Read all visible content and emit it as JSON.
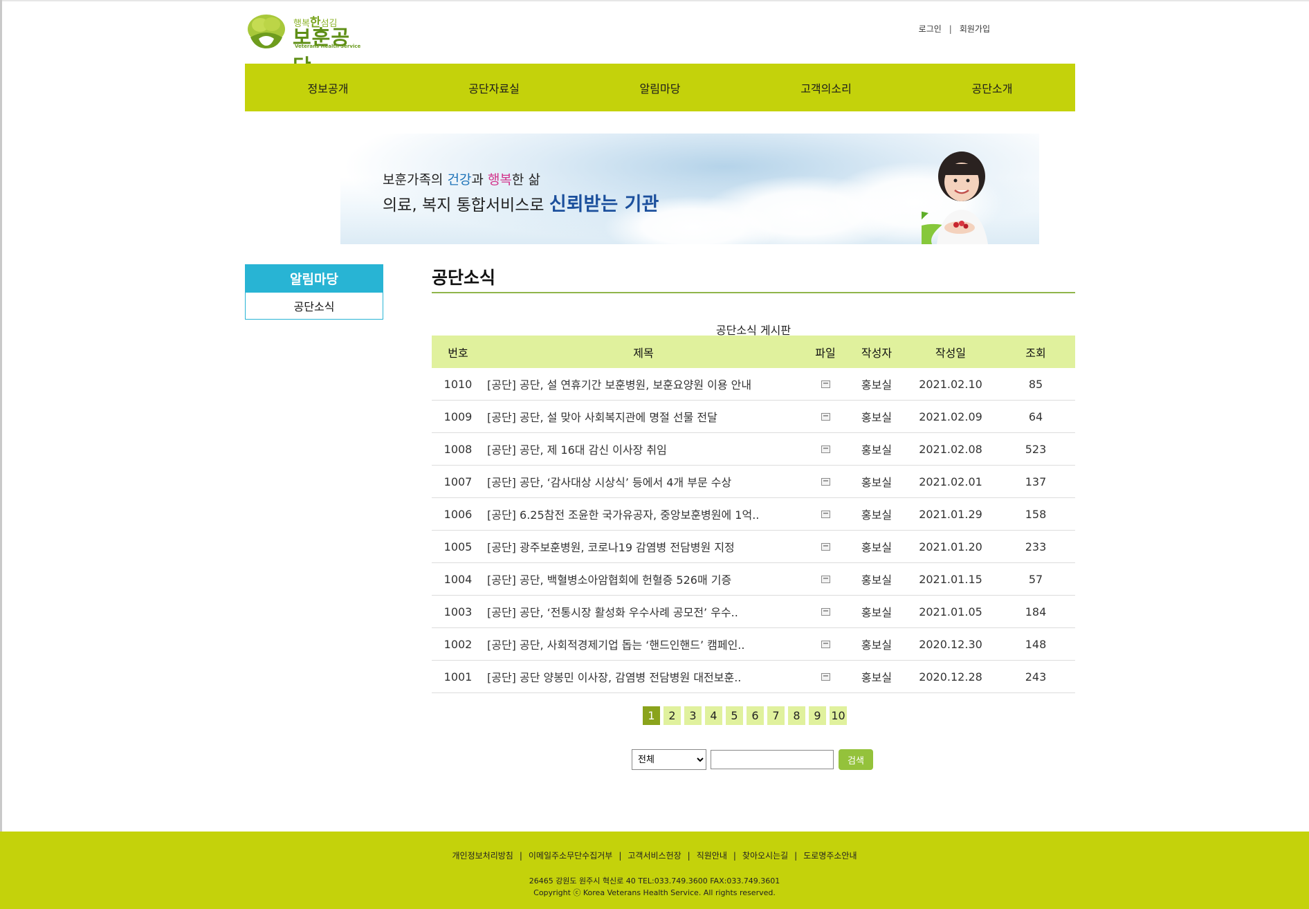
{
  "header": {
    "logo_tagline_pre": "행복",
    "logo_tagline_bold": "한",
    "logo_tagline_post": "섬김",
    "logo_main": "보훈공단",
    "logo_sub": "Veterans Health Service",
    "login": "로그인",
    "util_separator": "|",
    "signup": "회원가입"
  },
  "gnb": {
    "items": [
      "정보공개",
      "공단자료실",
      "알림마당",
      "고객의소리",
      "공단소개"
    ]
  },
  "banner": {
    "line1_a": "보훈가족의 ",
    "line1_b": "건강",
    "line1_c": "과 ",
    "line1_d": "행복",
    "line1_e": "한 삶",
    "line2_a": "의료, 복지 통합서비스로 ",
    "line2_b": "신뢰받는 기관"
  },
  "lnb": {
    "title": "알림마당",
    "item": "공단소식"
  },
  "content": {
    "title": "공단소식",
    "caption": "공단소식 게시판",
    "columns": [
      "번호",
      "제목",
      "파일",
      "작성자",
      "작성일",
      "조회"
    ],
    "rows": [
      {
        "no": "1010",
        "subject": "[공단] 공단, 설 연휴기간 보훈병원, 보훈요양원 이용 안내",
        "writer": "홍보실",
        "date": "2021.02.10",
        "views": "85"
      },
      {
        "no": "1009",
        "subject": "[공단] 공단, 설 맞아 사회복지관에 명절 선물 전달",
        "writer": "홍보실",
        "date": "2021.02.09",
        "views": "64"
      },
      {
        "no": "1008",
        "subject": "[공단] 공단, 제 16대 감신 이사장 취임",
        "writer": "홍보실",
        "date": "2021.02.08",
        "views": "523"
      },
      {
        "no": "1007",
        "subject": "[공단] 공단, ‘감사대상 시상식’ 등에서 4개 부문 수상",
        "writer": "홍보실",
        "date": "2021.02.01",
        "views": "137"
      },
      {
        "no": "1006",
        "subject": "[공단] 6.25참전 조윤한 국가유공자, 중앙보훈병원에 1억..",
        "writer": "홍보실",
        "date": "2021.01.29",
        "views": "158"
      },
      {
        "no": "1005",
        "subject": "[공단] 광주보훈병원, 코로나19 감염병 전담병원 지정",
        "writer": "홍보실",
        "date": "2021.01.20",
        "views": "233"
      },
      {
        "no": "1004",
        "subject": "[공단] 공단, 백혈병소아암협회에 헌혈증 526매 기증",
        "writer": "홍보실",
        "date": "2021.01.15",
        "views": "57"
      },
      {
        "no": "1003",
        "subject": "[공단] 공단, ‘전통시장 활성화 우수사례 공모전’ 우수..",
        "writer": "홍보실",
        "date": "2021.01.05",
        "views": "184"
      },
      {
        "no": "1002",
        "subject": "[공단] 공단, 사회적경제기업 돕는 ‘핸드인핸드’ 캠페인..",
        "writer": "홍보실",
        "date": "2020.12.30",
        "views": "148"
      },
      {
        "no": "1001",
        "subject": "[공단] 공단 양봉민 이사장, 감염병 전담병원 대전보훈..",
        "writer": "홍보실",
        "date": "2020.12.28",
        "views": "243"
      }
    ]
  },
  "pagination": {
    "pages": [
      "1",
      "2",
      "3",
      "4",
      "5",
      "6",
      "7",
      "8",
      "9",
      "10"
    ],
    "current": "1"
  },
  "search": {
    "select_value": "전체",
    "input_value": "",
    "button": "검색"
  },
  "footer": {
    "links": [
      "개인정보처리방침",
      "이메일주소무단수집거부",
      "고객서비스헌장",
      "직원안내",
      "찾아오시는길",
      "도로명주소안내"
    ],
    "separator": "|",
    "address": "26465 강원도 원주시 혁신로 40 TEL:033.749.3600 FAX:033.749.3601",
    "copyright": "Copyright ⓒ Korea Veterans Health Service. All rights reserved."
  },
  "colors": {
    "brand_green": "#c4d20b",
    "table_header": "#e0f19d",
    "lnb_blue": "#28b4d4",
    "pager_active": "#8aa31c",
    "search_button": "#94c23b"
  },
  "icons": {
    "file": "file-icon",
    "logo": "logo-tree-icon"
  }
}
